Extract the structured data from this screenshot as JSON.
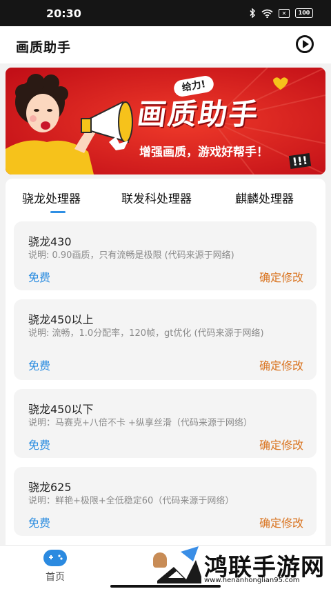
{
  "status_bar": {
    "time": "20:30",
    "battery": "100"
  },
  "app_bar": {
    "title": "画质助手"
  },
  "banner": {
    "tag": "给力!",
    "headline": "画质助手",
    "slogan": "增强画质，游戏好帮手！",
    "exclaim": "!!!"
  },
  "tabs": [
    {
      "label": "骁龙处理器",
      "active": true
    },
    {
      "label": "联发科处理器",
      "active": false
    },
    {
      "label": "麒麟处理器",
      "active": false
    }
  ],
  "cards": [
    {
      "name": "骁龙430",
      "desc": "说明: 0.90画质，只有流畅是极限 (代码来源于网络)",
      "price": "免费",
      "action": "确定修改"
    },
    {
      "name": "骁龙450以上",
      "desc": "说明: 流畅，1.0分配率，120帧，gt优化 (代码来源于网络)",
      "price": "免费",
      "action": "确定修改"
    },
    {
      "name": "骁龙450以下",
      "desc": "说明：马赛克+八倍不卡 +纵享丝滑（代码来源于网络）",
      "price": "免费",
      "action": "确定修改"
    },
    {
      "name": "骁龙625",
      "desc": "说明：鲜艳+极限+全低稳定60（代码来源于网络）",
      "price": "免费",
      "action": "确定修改"
    }
  ],
  "bottom_nav": {
    "home_label": "首页"
  },
  "watermark": {
    "name": "鸿联手游网",
    "url": "www.henanhonglian95.com"
  },
  "colors": {
    "accent_blue": "#2c8de0",
    "action_orange": "#d9731f",
    "banner_red": "#d9161c"
  }
}
